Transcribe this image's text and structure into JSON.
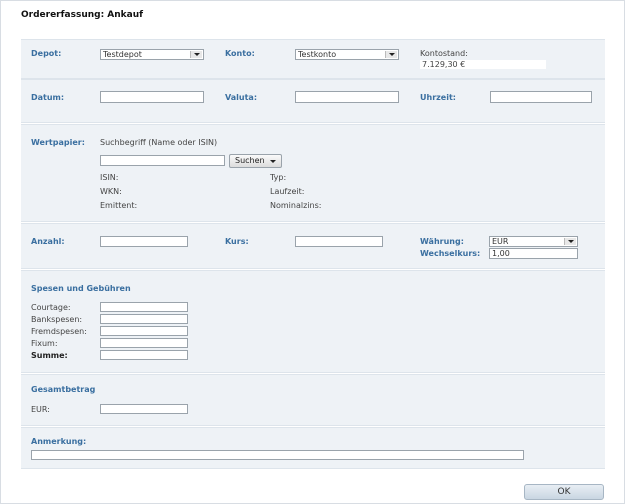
{
  "title": "Ordererfassung: Ankauf",
  "depot": {
    "label": "Depot:",
    "value": "Testdepot"
  },
  "konto": {
    "label": "Konto:",
    "value": "Testkonto"
  },
  "kontostand": {
    "label": "Kontostand:",
    "value": "7.129,30 €"
  },
  "datum": {
    "label": "Datum:",
    "value": ""
  },
  "valuta": {
    "label": "Valuta:",
    "value": ""
  },
  "uhrzeit": {
    "label": "Uhrzeit:",
    "value": ""
  },
  "wertpapier": {
    "label": "Wertpapier:",
    "hint": "Suchbegriff (Name oder ISIN)",
    "search_value": "",
    "search_button": "Suchen",
    "isin_label": "ISIN:",
    "wkn_label": "WKN:",
    "emittent_label": "Emittent:",
    "typ_label": "Typ:",
    "laufzeit_label": "Laufzeit:",
    "nominalzins_label": "Nominalzins:"
  },
  "anzahl": {
    "label": "Anzahl:",
    "value": ""
  },
  "kurs": {
    "label": "Kurs:",
    "value": ""
  },
  "waehrung": {
    "label": "Währung:",
    "value": "EUR"
  },
  "wechselkurs": {
    "label": "Wechselkurs:",
    "value": "1,00"
  },
  "spesen": {
    "heading": "Spesen und Gebühren",
    "courtage": "Courtage:",
    "bankspesen": "Bankspesen:",
    "fremdspesen": "Fremdspesen:",
    "fixum": "Fixum:",
    "summe": "Summe:"
  },
  "gesamtbetrag": {
    "heading": "Gesamtbetrag",
    "currency_label": "EUR:",
    "value": ""
  },
  "anmerkung": {
    "label": "Anmerkung:",
    "value": ""
  },
  "ok_button": "OK"
}
